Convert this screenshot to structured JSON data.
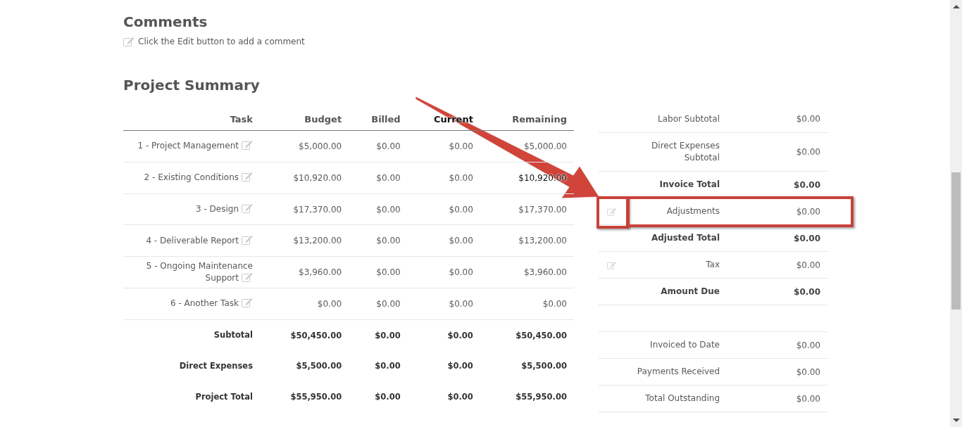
{
  "comments": {
    "title": "Comments",
    "hint": "Click the Edit button to add a comment"
  },
  "summary": {
    "title": "Project Summary",
    "columns": [
      "Task",
      "Budget",
      "Billed",
      "Current",
      "Remaining"
    ],
    "rows": [
      {
        "kind": "task",
        "task": "1 - Project Management",
        "budget": "$5,000.00",
        "billed": "$0.00",
        "current": "$0.00",
        "remaining": "$5,000.00"
      },
      {
        "kind": "task",
        "task": "2 - Existing Conditions",
        "budget": "$10,920.00",
        "billed": "$0.00",
        "current": "$0.00",
        "remaining": "$10,920.00"
      },
      {
        "kind": "task",
        "task": "3 - Design",
        "budget": "$17,370.00",
        "billed": "$0.00",
        "current": "$0.00",
        "remaining": "$17,370.00"
      },
      {
        "kind": "task",
        "task": "4 - Deliverable Report",
        "budget": "$13,200.00",
        "billed": "$0.00",
        "current": "$0.00",
        "remaining": "$13,200.00"
      },
      {
        "kind": "task",
        "task": "5 - Ongoing Maintenance Support",
        "budget": "$3,960.00",
        "billed": "$0.00",
        "current": "$0.00",
        "remaining": "$3,960.00"
      },
      {
        "kind": "task",
        "task": "6 - Another Task",
        "budget": "$0.00",
        "billed": "$0.00",
        "current": "$0.00",
        "remaining": "$0.00"
      },
      {
        "kind": "total",
        "task": "Subtotal",
        "budget": "$50,450.00",
        "billed": "$0.00",
        "current": "$0.00",
        "remaining": "$50,450.00"
      },
      {
        "kind": "total",
        "task": "Direct Expenses",
        "budget": "$5,500.00",
        "billed": "$0.00",
        "current": "$0.00",
        "remaining": "$5,500.00"
      },
      {
        "kind": "total",
        "task": "Project Total",
        "budget": "$55,950.00",
        "billed": "$0.00",
        "current": "$0.00",
        "remaining": "$55,950.00"
      }
    ]
  },
  "totals": [
    {
      "kind": "normal",
      "label": "Labor Subtotal",
      "value": "$0.00",
      "highlighted": false
    },
    {
      "kind": "normal",
      "label": "Direct Expenses Subtotal",
      "value": "$0.00",
      "highlighted": false
    },
    {
      "kind": "total",
      "label": "Invoice Total",
      "value": "$0.00",
      "highlighted": false
    },
    {
      "kind": "normal",
      "label": "Adjustments",
      "value": "$0.00",
      "editable": true,
      "highlighted": true
    },
    {
      "kind": "total",
      "label": "Adjusted Total",
      "value": "$0.00",
      "highlighted": false
    },
    {
      "kind": "normal",
      "label": "Tax",
      "value": "$0.00",
      "editable": true,
      "highlighted": false
    },
    {
      "kind": "total",
      "label": "Amount Due",
      "value": "$0.00",
      "highlighted": false
    },
    {
      "kind": "blank"
    },
    {
      "kind": "normal",
      "label": "Invoiced to Date",
      "value": "$0.00",
      "highlighted": false
    },
    {
      "kind": "normal",
      "label": "Payments Received",
      "value": "$0.00",
      "highlighted": false
    },
    {
      "kind": "normal",
      "label": "Total Outstanding",
      "value": "$0.00",
      "highlighted": false
    }
  ]
}
